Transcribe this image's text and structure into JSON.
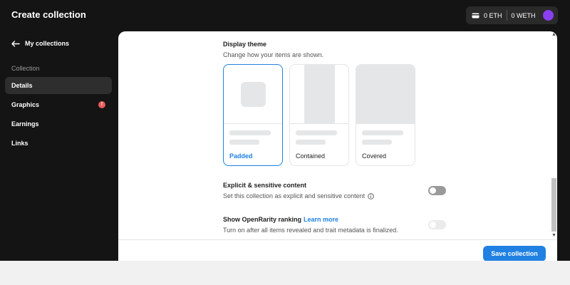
{
  "header": {
    "title": "Create collection",
    "wallet": {
      "eth": "0 ETH",
      "weth": "0 WETH"
    }
  },
  "sidebar": {
    "back_label": "My collections",
    "section_label": "Collection",
    "items": [
      {
        "label": "Details",
        "active": true
      },
      {
        "label": "Graphics",
        "badge": "!"
      },
      {
        "label": "Earnings"
      },
      {
        "label": "Links"
      }
    ]
  },
  "display_theme": {
    "title": "Display theme",
    "description": "Change how your items are shown.",
    "options": [
      {
        "label": "Padded",
        "selected": true
      },
      {
        "label": "Contained"
      },
      {
        "label": "Covered"
      }
    ]
  },
  "explicit": {
    "title": "Explicit & sensitive content",
    "description": "Set this collection as explicit and sensitive content",
    "enabled": false
  },
  "rarity": {
    "title": "Show OpenRarity ranking",
    "link": "Learn more",
    "description": "Turn on after all items revealed and trait metadata is finalized.",
    "enabled": false
  },
  "footer": {
    "save_label": "Save collection"
  },
  "colors": {
    "accent": "#2081e2",
    "badge": "#e55b5b",
    "avatar": "#8a3ff0",
    "sidebar_bg": "#141414"
  }
}
